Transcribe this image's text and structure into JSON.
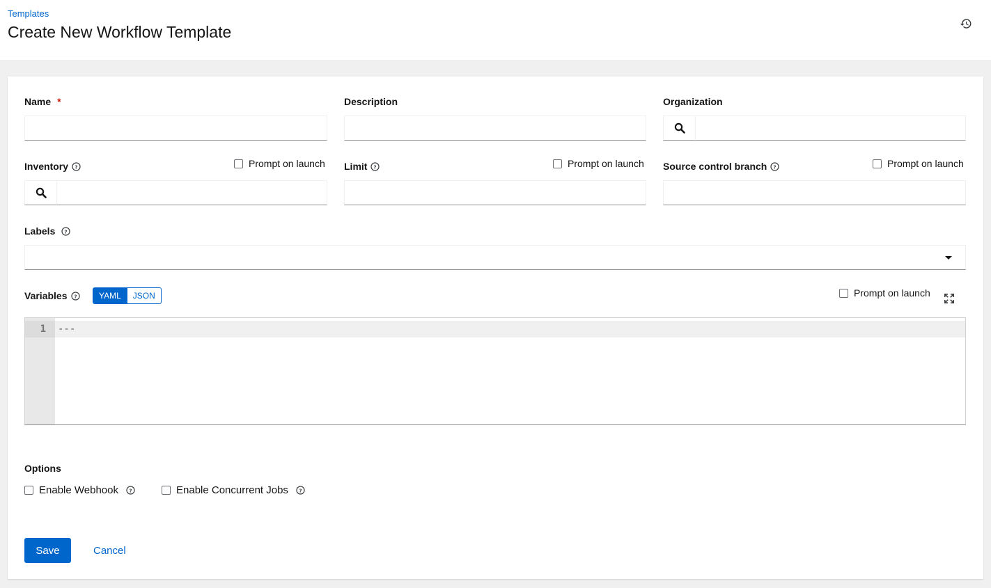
{
  "header": {
    "breadcrumb": "Templates",
    "title": "Create New Workflow Template",
    "history_icon": "history-icon"
  },
  "form": {
    "name": {
      "label": "Name",
      "required_marker": "*",
      "value": ""
    },
    "description": {
      "label": "Description",
      "value": ""
    },
    "organization": {
      "label": "Organization",
      "value": "",
      "icon": "search-icon"
    },
    "inventory": {
      "label": "Inventory",
      "value": "",
      "icon": "search-icon",
      "prompt_label": "Prompt on launch"
    },
    "limit": {
      "label": "Limit",
      "value": "",
      "prompt_label": "Prompt on launch"
    },
    "scm_branch": {
      "label": "Source control branch",
      "value": "",
      "prompt_label": "Prompt on launch"
    },
    "labels": {
      "label": "Labels",
      "value": ""
    },
    "variables": {
      "label": "Variables",
      "modes": [
        "YAML",
        "JSON"
      ],
      "active_mode": "YAML",
      "prompt_label": "Prompt on launch",
      "line_number": "1",
      "code": "---"
    },
    "options": {
      "label": "Options",
      "webhook": "Enable Webhook",
      "concurrent": "Enable Concurrent Jobs"
    }
  },
  "actions": {
    "save": "Save",
    "cancel": "Cancel"
  },
  "colors": {
    "accent": "#0066cc",
    "required": "#c9190b",
    "page_bg": "#f0f0f0"
  }
}
